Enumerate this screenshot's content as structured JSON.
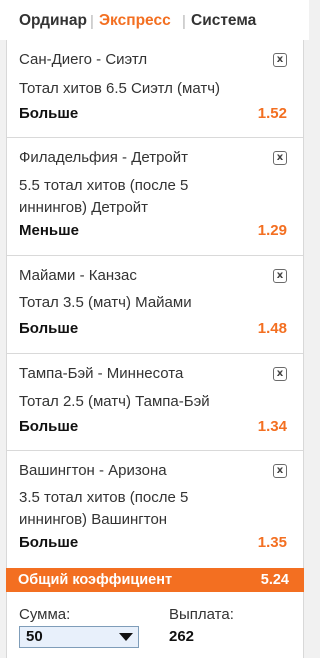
{
  "tabs": [
    {
      "label": "Ординар",
      "active": false
    },
    {
      "label": "Экспресс",
      "active": true
    },
    {
      "label": "Система",
      "active": false
    }
  ],
  "separator": "|",
  "bets": [
    {
      "match": "Сан-Диего - Сиэтл",
      "market": "Тотал хитов 6.5 Сиэтл (матч)",
      "outcome": "Больше",
      "odds": "1.52"
    },
    {
      "match": "Филадельфия - Детройт",
      "market": "5.5 тотал хитов (после 5 иннингов) Детройт",
      "outcome": "Меньше",
      "odds": "1.29"
    },
    {
      "match": "Майами - Канзас",
      "market": "Тотал 3.5 (матч) Майами",
      "outcome": "Больше",
      "odds": "1.48"
    },
    {
      "match": "Тампа-Бэй - Миннесота",
      "market": "Тотал 2.5 (матч) Тампа-Бэй",
      "outcome": "Больше",
      "odds": "1.34"
    },
    {
      "match": "Вашингтон - Аризона",
      "market": "3.5 тотал хитов (после 5 иннингов) Вашингтон",
      "outcome": "Больше",
      "odds": "1.35"
    }
  ],
  "remove_icon_glyph": "x",
  "total": {
    "label": "Общий коэффициент",
    "value": "5.24"
  },
  "stake": {
    "label": "Сумма:",
    "value": "50"
  },
  "payout": {
    "label": "Выплата:",
    "value": "262"
  },
  "colors": {
    "accent": "#f36f21",
    "panel": "#ffffff",
    "background": "#f1f1f1",
    "divider": "#d9d9d9"
  },
  "icons": {
    "remove": "close-box-icon",
    "dropdown": "chevron-down-icon"
  }
}
